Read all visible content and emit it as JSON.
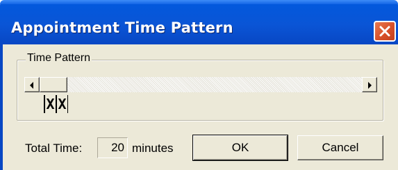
{
  "window": {
    "title": "Appointment Time Pattern"
  },
  "time_pattern": {
    "group_label": "Time Pattern",
    "slots": [
      "X",
      "X"
    ],
    "scroll_left_icon": "arrow-left-icon",
    "scroll_right_icon": "arrow-right-icon"
  },
  "total": {
    "label": "Total Time:",
    "value": "20",
    "unit": "minutes"
  },
  "buttons": {
    "ok": "OK",
    "cancel": "Cancel"
  },
  "colors": {
    "titlebar": "#0a55d6",
    "dialog_bg": "#ece9d8",
    "close": "#d8502a"
  }
}
